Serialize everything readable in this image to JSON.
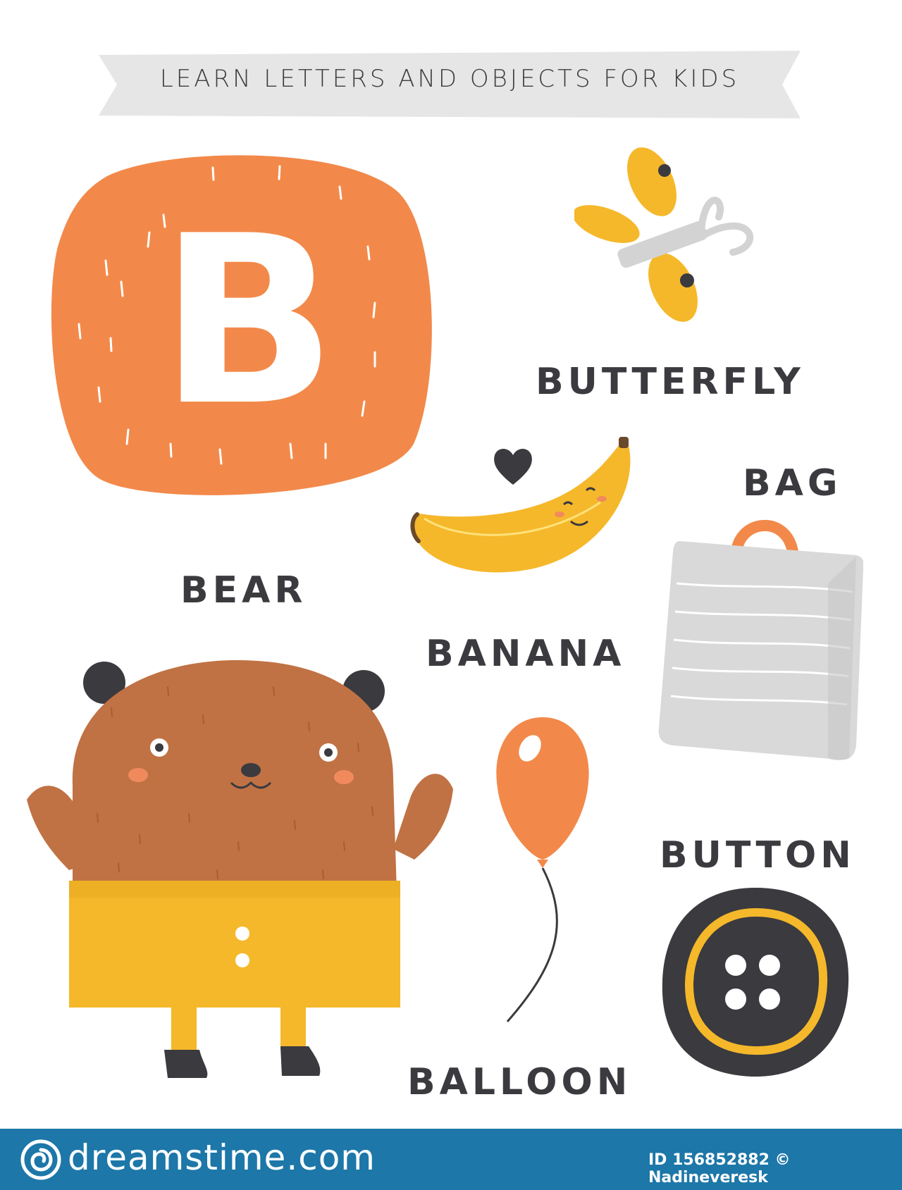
{
  "title": "LEARN LETTERS AND OBJECTS FOR KIDS",
  "letter": "B",
  "words": {
    "butterfly": "BUTTERFLY",
    "bag": "BAG",
    "bear": "BEAR",
    "banana": "BANANA",
    "button": "BUTTON",
    "balloon": "BALLOON"
  },
  "watermark": "dreamstime",
  "footer": {
    "brand": "dreamstime.com",
    "id_text": "ID 156852882 © Nadineveresk"
  },
  "colors": {
    "orange": "#f2894a",
    "bear_brown": "#c07244",
    "yellow": "#f5b82b",
    "dark": "#3a3a3f",
    "gray": "#d8d8d8",
    "footer": "#1d77a8"
  }
}
